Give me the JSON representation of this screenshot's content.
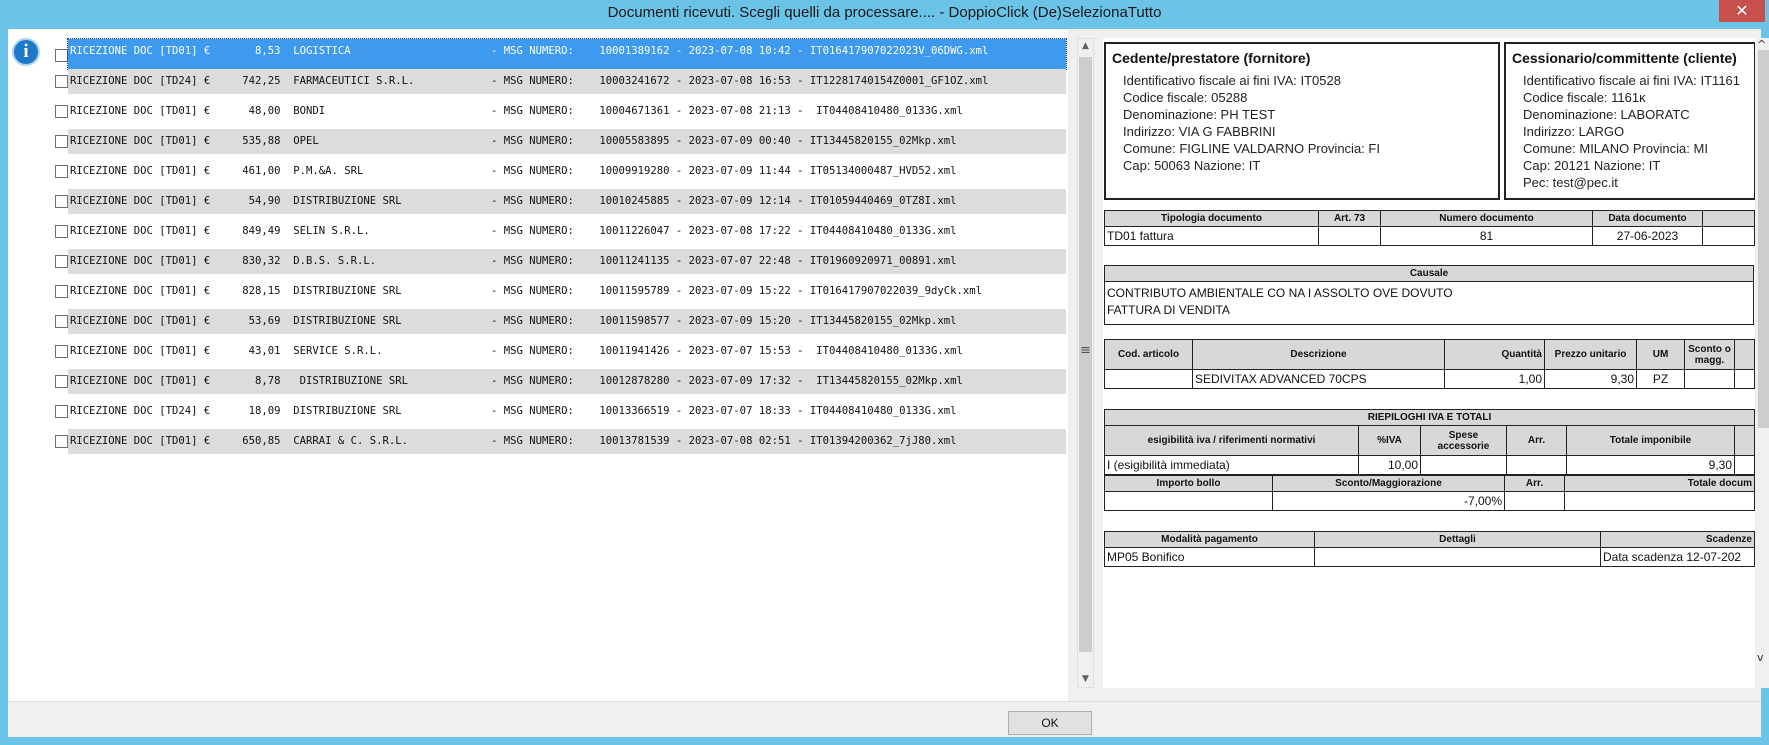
{
  "window": {
    "title": "Documenti ricevuti. Scegli quelli da processare.... - DoppioClick (De)SelezionaTutto",
    "close_glyph": "✕"
  },
  "list": {
    "rows": [
      "RICEZIONE DOC [TD01] €       8,53  LOGISTICA                      - MSG NUMERO:    10001389162 - 2023-07-08 10:42 - IT016417907022023V_06DWG.xml",
      "RICEZIONE DOC [TD24] €     742,25  FARMACEUTICI S.R.L.            - MSG NUMERO:    10003241672 - 2023-07-08 16:53 - IT12281740154Z0001_GF1OZ.xml",
      "RICEZIONE DOC [TD01] €      48,00  BONDI                          - MSG NUMERO:    10004671361 - 2023-07-08 21:13 -  IT04408410480_0133G.xml",
      "RICEZIONE DOC [TD01] €     535,88  OPEL                           - MSG NUMERO:    10005583895 - 2023-07-09 00:40 - IT13445820155_02Mkp.xml",
      "RICEZIONE DOC [TD01] €     461,00  P.M.&A. SRL                    - MSG NUMERO:    10009919280 - 2023-07-09 11:44 - IT05134000487_HVD52.xml",
      "RICEZIONE DOC [TD01] €      54,90  DISTRIBUZIONE SRL              - MSG NUMERO:    10010245885 - 2023-07-09 12:14 - IT01059440469_0TZ8I.xml",
      "RICEZIONE DOC [TD01] €     849,49  SELIN S.R.L.                   - MSG NUMERO:    10011226047 - 2023-07-08 17:22 - IT04408410480_0133G.xml",
      "RICEZIONE DOC [TD01] €     830,32  D.B.S. S.R.L.                  - MSG NUMERO:    10011241135 - 2023-07-07 22:48 - IT01960920971_00891.xml",
      "RICEZIONE DOC [TD01] €     828,15  DISTRIBUZIONE SRL              - MSG NUMERO:    10011595789 - 2023-07-09 15:22 - IT016417907022039_9dyCk.xml",
      "RICEZIONE DOC [TD01] €      53,69  DISTRIBUZIONE SRL              - MSG NUMERO:    10011598577 - 2023-07-09 15:20 - IT13445820155_02Mkp.xml",
      "RICEZIONE DOC [TD01] €      43,01  SERVICE S.R.L.                 - MSG NUMERO:    10011941426 - 2023-07-07 15:53 -  IT04408410480_0133G.xml",
      "RICEZIONE DOC [TD01] €       8,78   DISTRIBUZIONE SRL             - MSG NUMERO:    10012878280 - 2023-07-09 17:32 -  IT13445820155_02Mkp.xml",
      "RICEZIONE DOC [TD24] €      18,09  DISTRIBUZIONE SRL              - MSG NUMERO:    10013366519 - 2023-07-07 18:33 - IT04408410480_0133G.xml",
      "RICEZIONE DOC [TD01] €     650,85  CARRAI & C. S.R.L.             - MSG NUMERO:    10013781539 - 2023-07-08 02:51 - IT01394200362_7jJ80.xml"
    ]
  },
  "cedente": {
    "title": "Cedente/prestatore (fornitore)",
    "lines": [
      "Identificativo fiscale ai fini IVA: IT0528",
      "Codice fiscale: 05288",
      "Denominazione: PH TEST",
      "Indirizzo: VIA G FABBRINI",
      "Comune: FIGLINE VALDARNO Provincia: FI",
      "Cap: 50063 Nazione: IT"
    ]
  },
  "cessionario": {
    "title": "Cessionario/committente (cliente)",
    "lines": [
      "Identificativo fiscale ai fini IVA: IT1161",
      "Codice fiscale: 1161ĸ",
      "Denominazione: LABORATC",
      "Indirizzo: LARGO",
      "Comune: MILANO Provincia: MI",
      "Cap: 20121 Nazione: IT",
      "Pec: test@pec.it"
    ]
  },
  "doc_table": {
    "headers": [
      "Tipologia documento",
      "Art. 73",
      "Numero documento",
      "Data documento"
    ],
    "row": [
      "TD01 fattura",
      "",
      "81",
      "27-06-2023"
    ]
  },
  "causale": {
    "header": "Causale",
    "lines": [
      "CONTRIBUTO AMBIENTALE CO NA I ASSOLTO OVE DOVUTO",
      "FATTURA DI VENDITA"
    ]
  },
  "items_table": {
    "headers": [
      "Cod. articolo",
      "Descrizione",
      "Quantità",
      "Prezzo unitario",
      "UM",
      "Sconto o magg."
    ],
    "row": [
      "",
      "SEDIVITAX ADVANCED 70CPS",
      "1,00",
      "9,30",
      "PZ",
      ""
    ]
  },
  "riepilogo": {
    "title": "RIEPILOGHI IVA E TOTALI",
    "headers": [
      "esigibilità iva / riferimenti normativi",
      "%IVA",
      "Spese accessorie",
      "Arr.",
      "Totale imponibile"
    ],
    "row": [
      "I (esigibilità immediata)",
      "10,00",
      "",
      "",
      "9,30"
    ],
    "headers2": [
      "Importo bollo",
      "Sconto/Maggiorazione",
      "Arr.",
      "Totale docum"
    ],
    "row2": [
      "",
      "-7,00%",
      "",
      ""
    ]
  },
  "pagamento": {
    "headers": [
      "Modalità pagamento",
      "Dettagli",
      "Scadenze"
    ],
    "row": [
      "MP05 Bonifico",
      "",
      "Data scadenza 12-07-202"
    ]
  },
  "buttons": {
    "ok": "OK"
  },
  "icons": {
    "info": "i",
    "splitter": "≡",
    "up": "▲",
    "down": "▼",
    "right_up": "^",
    "right_down": "v"
  }
}
